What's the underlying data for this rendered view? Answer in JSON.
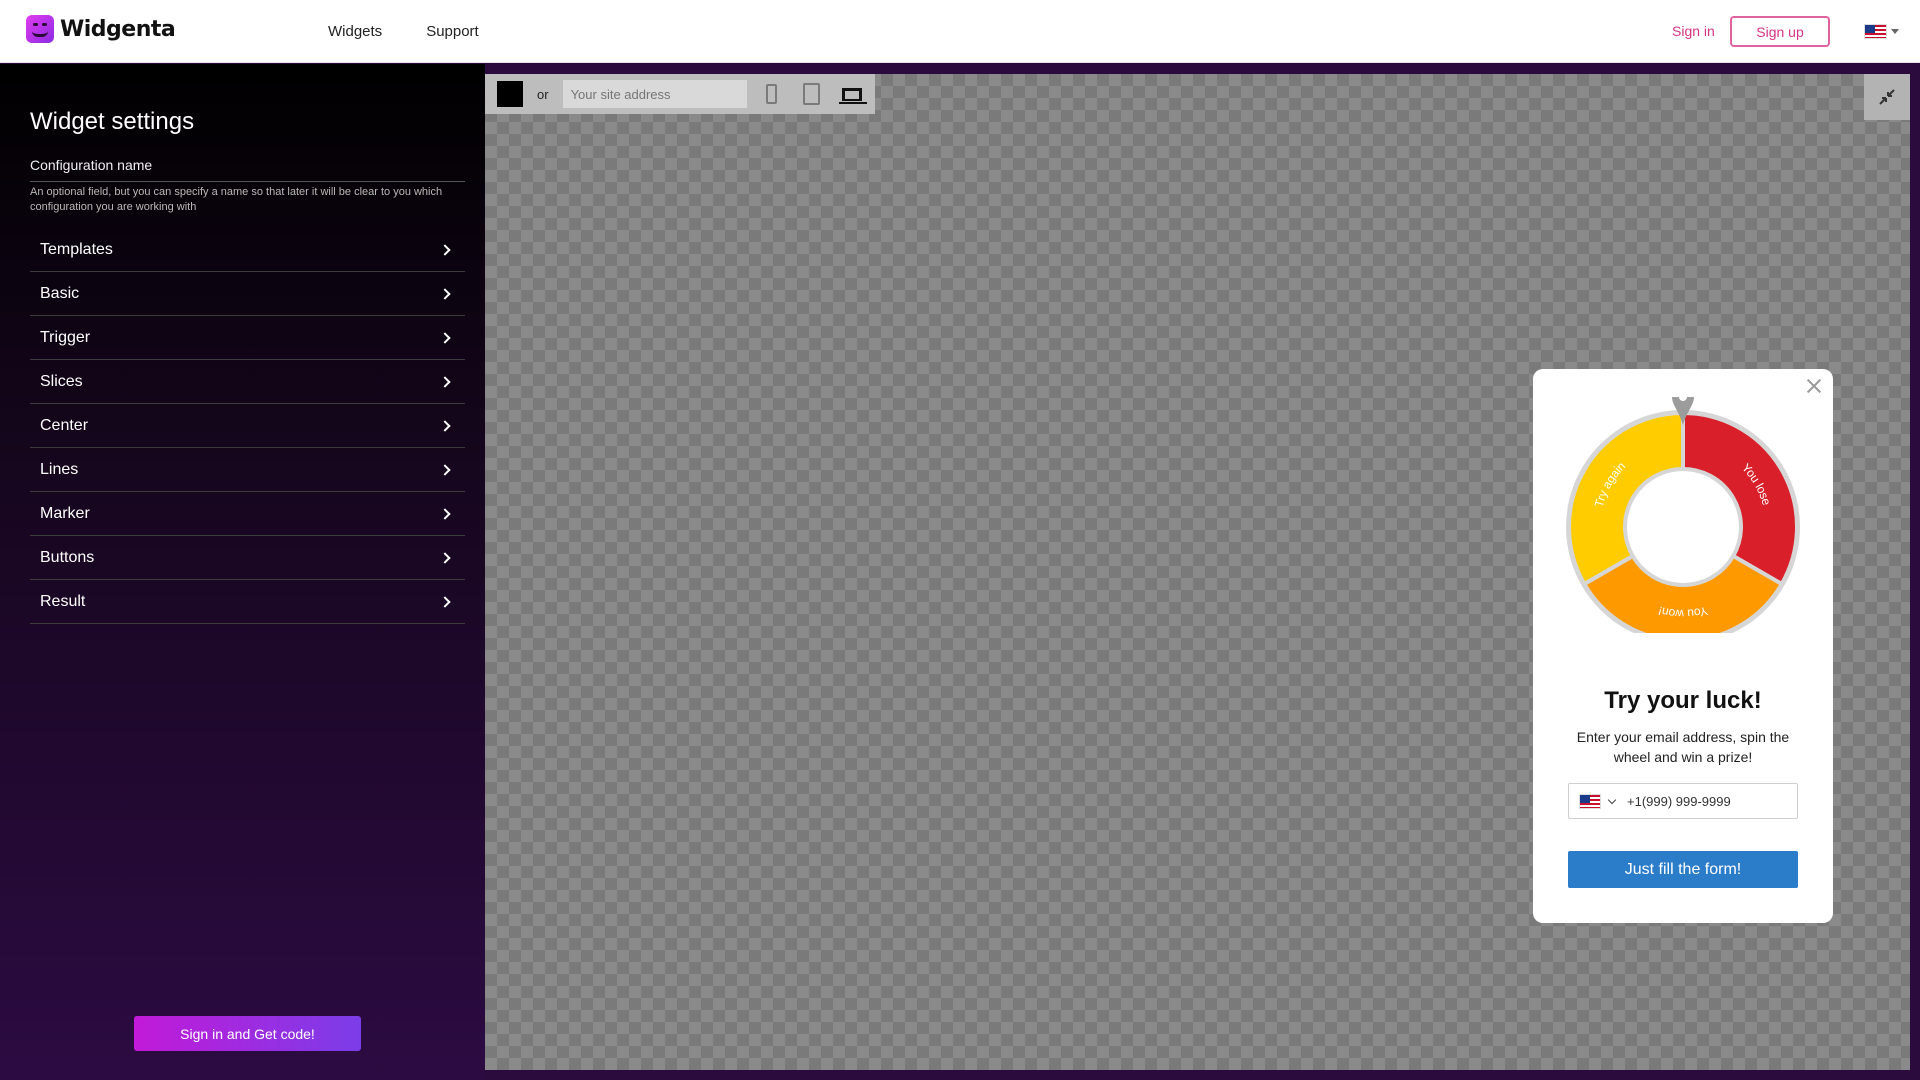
{
  "header": {
    "brand": "Widgenta",
    "nav": [
      "Widgets",
      "Support"
    ],
    "signin_label": "Sign in",
    "signup_label": "Sign up",
    "language_icon": "us-flag-icon"
  },
  "sidebar": {
    "title": "Widget settings",
    "config_label": "Configuration name",
    "config_help": "An optional field, but you can specify a name so that later it will be clear to you which configuration you are working with",
    "sections": [
      "Templates",
      "Basic",
      "Trigger",
      "Slices",
      "Center",
      "Lines",
      "Marker",
      "Buttons",
      "Result"
    ],
    "get_code_label": "Sign in and Get code!"
  },
  "preview": {
    "color_swatch": "#000000",
    "or_label": "or",
    "site_placeholder": "Your site address",
    "devices": [
      "phone-icon",
      "tablet-icon",
      "laptop-icon"
    ],
    "collapse_icon": "collapse-icon"
  },
  "widget": {
    "title": "Try your luck!",
    "text": "Enter your email address, spin the wheel and win a prize!",
    "phone_placeholder": "+1(999) 999-9999",
    "submit_label": "Just fill the form!",
    "slices": [
      {
        "label": "You lose",
        "color": "#d9202a"
      },
      {
        "label": "You won!",
        "color": "#ff9900"
      },
      {
        "label": "Try again",
        "color": "#ffcc00"
      }
    ]
  }
}
